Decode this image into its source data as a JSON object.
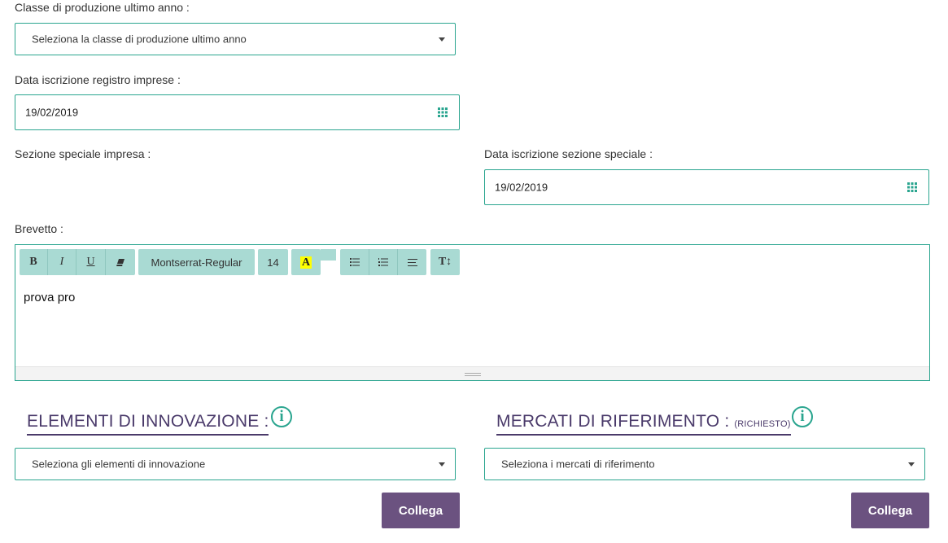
{
  "form": {
    "production_class": {
      "label": "Classe di produzione ultimo anno :",
      "placeholder": "Seleziona la classe di produzione ultimo anno"
    },
    "registry_date": {
      "label": "Data iscrizione registro imprese :",
      "value": "19/02/2019"
    },
    "special_section": {
      "label": "Sezione speciale impresa :"
    },
    "special_section_date": {
      "label": "Data iscrizione sezione speciale :",
      "value": "19/02/2019"
    },
    "patent": {
      "label": "Brevetto :",
      "content": "prova pro"
    }
  },
  "editor_toolbar": {
    "bold": "B",
    "italic": "I",
    "underline": "U",
    "font_family": "Montserrat-Regular",
    "font_size": "14",
    "highlight": "A",
    "text_height": "T↕"
  },
  "innovation": {
    "title": "ELEMENTI DI INNOVAZIONE :",
    "placeholder": "Seleziona gli elementi di innovazione",
    "button": "Collega"
  },
  "markets": {
    "title": "MERCATI DI RIFERIMENTO :",
    "required_note": "(RICHIESTO)",
    "placeholder": "Seleziona i mercati di riferimento",
    "button": "Collega"
  },
  "info_icon_glyph": "i",
  "colors": {
    "accent_teal": "#2aa58f",
    "toolbar_bg": "#a9dad3",
    "title_purple": "#4a3a6a",
    "button_purple": "#6b5280",
    "highlight_yellow": "#ffff00"
  }
}
